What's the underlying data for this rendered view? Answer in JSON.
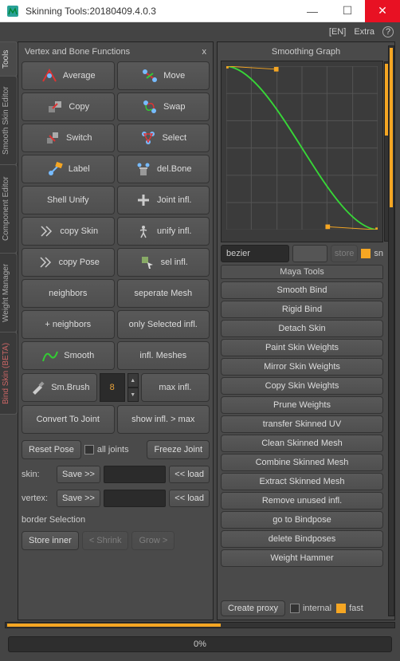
{
  "window": {
    "title": "Skinning Tools:20180409.4.0.3"
  },
  "toprow": {
    "lang": "[EN]",
    "extra": "Extra",
    "help": "?"
  },
  "vtabs": {
    "tools": "Tools",
    "smooth": "Smooth Skin Editor",
    "component": "Component Editor",
    "weight": "Weight Manager",
    "bind": "Bind Skin (BETA)"
  },
  "left": {
    "title": "Vertex and Bone Functions",
    "close": "x",
    "buttons": {
      "average": "Average",
      "move": "Move",
      "copy": "Copy",
      "swap": "Swap",
      "switch": "Switch",
      "select": "Select",
      "label": "Label",
      "delbone": "del.Bone",
      "shellunify": "Shell Unify",
      "jointinfl": "Joint infl.",
      "copyskin": "copy Skin",
      "unifyinfl": "unify infl.",
      "copypose": "copy Pose",
      "selinfl": "sel infl.",
      "neighbors": "neighbors",
      "sepmesh": "seperate Mesh",
      "plusneighbors": "+ neighbors",
      "onlyselected": "only Selected infl.",
      "smooth": "Smooth",
      "inflmeshes": "infl. Meshes",
      "smbrush": "Sm.Brush",
      "maxinfl": "max infl.",
      "convert": "Convert To Joint",
      "showinfl": "show infl. > max"
    },
    "spin_value": "8",
    "resetpose": "Reset Pose",
    "alljoints": "all joints",
    "freeze": "Freeze Joint",
    "skin_label": "skin:",
    "vertex_label": "vertex:",
    "save": "Save >>",
    "load": "<< load",
    "border_label": "border Selection",
    "storeinner": "Store inner",
    "shrink": "< Shrink",
    "grow": "Grow >"
  },
  "right": {
    "title": "Smoothing Graph",
    "bezier": "bezier",
    "store": "store",
    "sn": "sn",
    "maya_title": "Maya Tools",
    "maya": {
      "smoothbind": "Smooth Bind",
      "rigidbind": "Rigid Bind",
      "detach": "Detach Skin",
      "paint": "Paint Skin Weights",
      "mirror": "Mirror Skin Weights",
      "copyskin": "Copy Skin Weights",
      "prune": "Prune Weights",
      "transferuv": "transfer Skinned UV",
      "clean": "Clean Skinned Mesh",
      "combine": "Combine Skinned Mesh",
      "extract": "Extract Skinned Mesh",
      "removeunused": "Remove unused infl.",
      "bindpose": "go to Bindpose",
      "deletebind": "delete Bindposes",
      "hammer": "Weight Hammer"
    },
    "proxy": "Create proxy",
    "internal": "internal",
    "fast": "fast"
  },
  "progress": "0%",
  "chart_data": {
    "type": "line",
    "title": "Smoothing Graph",
    "x": [
      0.0,
      0.33,
      0.67,
      1.0
    ],
    "y": [
      1.0,
      0.98,
      0.02,
      0.0
    ],
    "control_points": [
      {
        "x": 0.0,
        "y": 1.0
      },
      {
        "x": 0.33,
        "y": 0.98
      },
      {
        "x": 0.67,
        "y": 0.02
      },
      {
        "x": 1.0,
        "y": 0.0
      }
    ],
    "xlim": [
      0,
      1
    ],
    "ylim": [
      0,
      1
    ],
    "curve_type": "bezier",
    "line_color": "#37d637",
    "handle_color": "#f5a623"
  }
}
